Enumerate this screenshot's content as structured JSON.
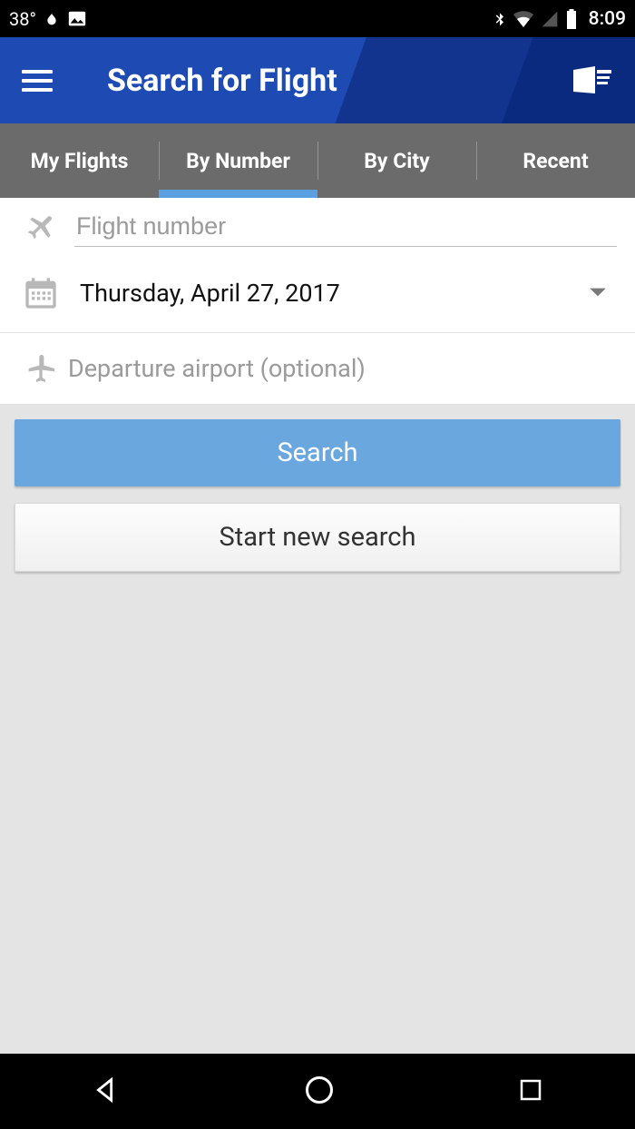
{
  "status": {
    "temperature": "38°",
    "time": "8:09"
  },
  "header": {
    "title": "Search for Flight"
  },
  "tabs": [
    {
      "label": "My Flights",
      "active": false
    },
    {
      "label": "By Number",
      "active": true
    },
    {
      "label": "By City",
      "active": false
    },
    {
      "label": "Recent",
      "active": false
    }
  ],
  "form": {
    "flight_number_placeholder": "Flight number",
    "flight_number_value": "",
    "date_label": "Thursday, April 27, 2017",
    "departure_placeholder": "Departure airport (optional)"
  },
  "buttons": {
    "search": "Search",
    "start_new": "Start new search"
  },
  "colors": {
    "accent": "#6aa7de",
    "primary_blue": "#1e4ab3"
  }
}
